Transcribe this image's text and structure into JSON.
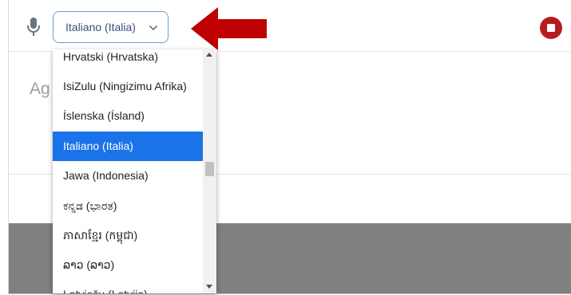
{
  "toolbar": {
    "language_select": {
      "value": "Italiano (Italia)"
    },
    "icons": {
      "mic": "microphone-icon",
      "chevron": "chevron-down-icon",
      "stop": "stop-icon",
      "arrow": "red-arrow-annotation"
    }
  },
  "editor": {
    "placeholder": "Ag"
  },
  "dropdown": {
    "options": [
      {
        "label": "Hrvatski (Hrvatska)",
        "selected": false
      },
      {
        "label": "IsiZulu (Ningizimu Afrika)",
        "selected": false
      },
      {
        "label": "Íslenska (Ísland)",
        "selected": false
      },
      {
        "label": "Italiano (Italia)",
        "selected": true
      },
      {
        "label": "Jawa (Indonesia)",
        "selected": false
      },
      {
        "label": "ಕನ್ನಡ (ಭಾರತ)",
        "selected": false
      },
      {
        "label": "ភាសាខ្មែរ (កម្ពុជា)",
        "selected": false
      },
      {
        "label": "ລາວ (ລາວ)",
        "selected": false
      },
      {
        "label": "Latviešu (Latvija)",
        "selected": false
      }
    ]
  },
  "colors": {
    "accent_blue": "#1a73e8",
    "select_border": "#6e9ccf",
    "stop_red": "#b71c1c",
    "arrow_red": "#c00000",
    "gray_area": "#808080"
  }
}
